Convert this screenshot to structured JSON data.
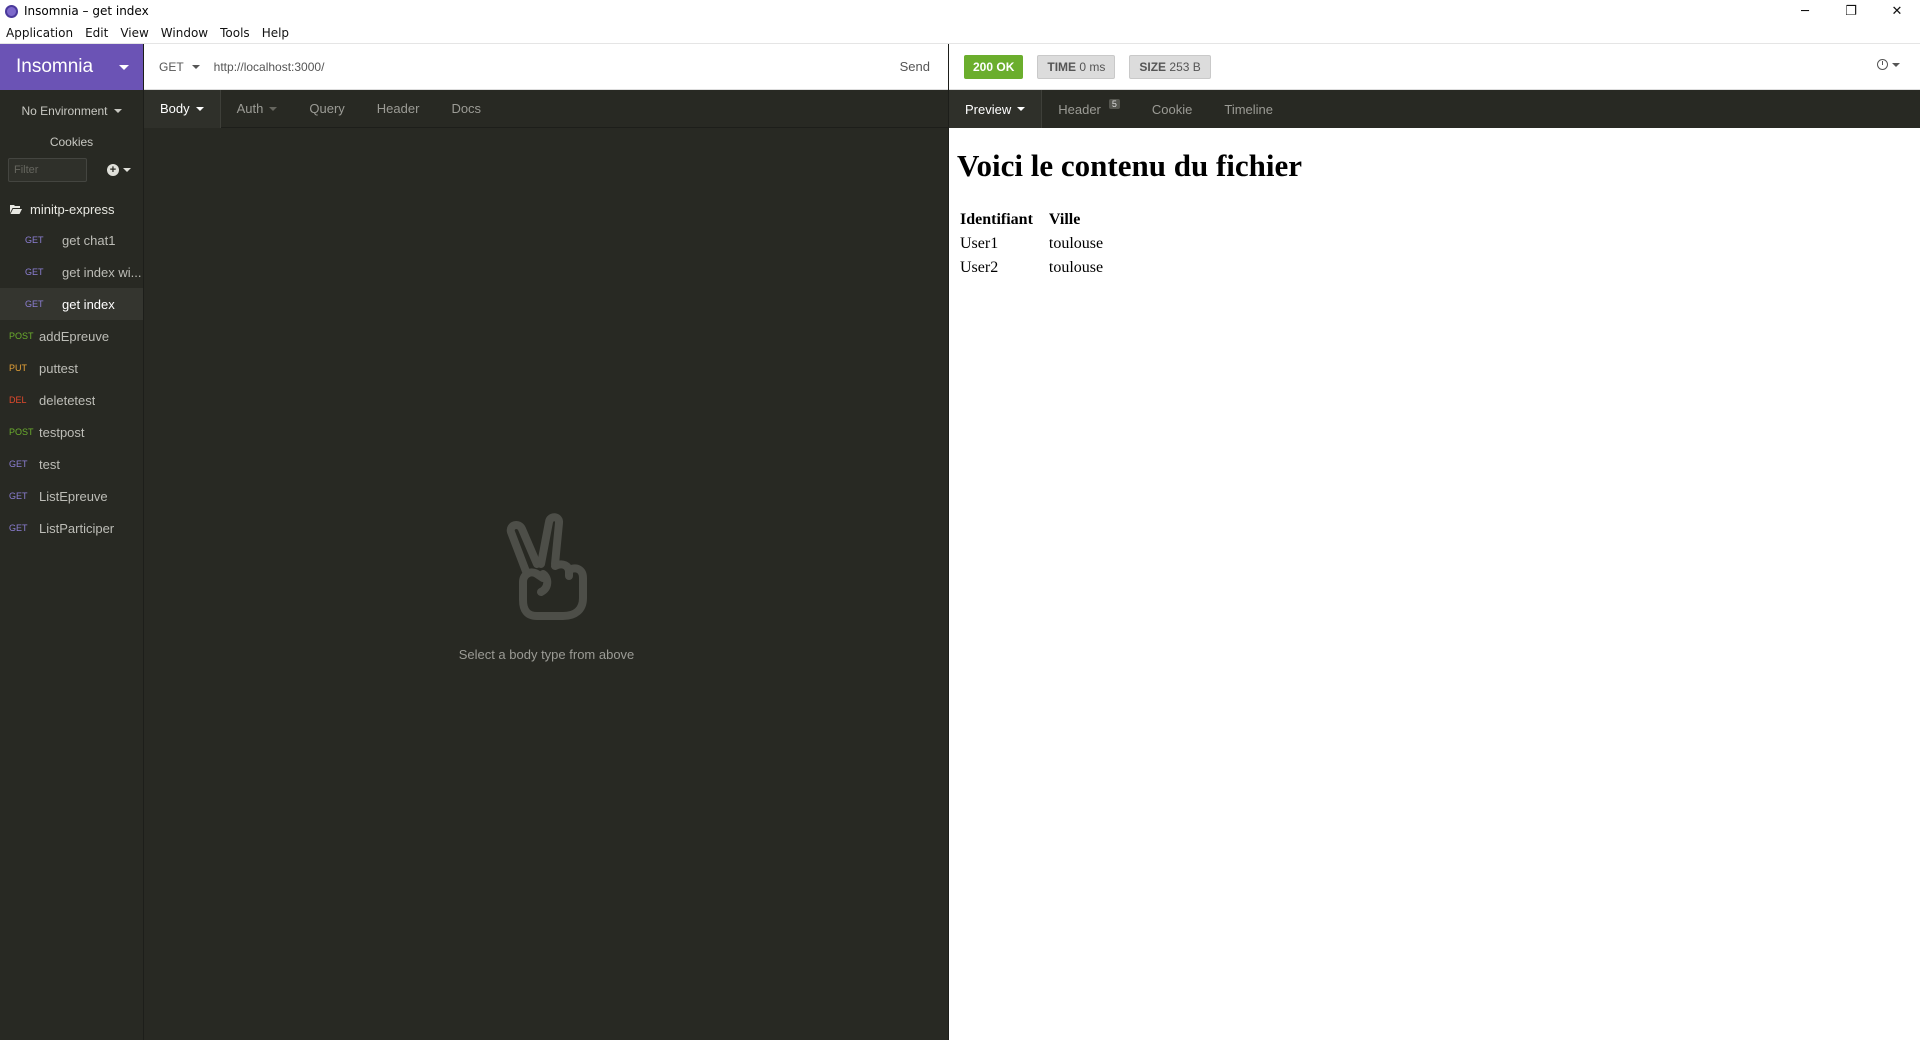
{
  "window": {
    "title": "Insomnia – get index",
    "controls": {
      "minimize": "─",
      "restore": "❐",
      "close": "✕"
    }
  },
  "menu": [
    "Application",
    "Edit",
    "View",
    "Window",
    "Tools",
    "Help"
  ],
  "sidebar": {
    "brand": "Insomnia",
    "environment": "No Environment",
    "cookies": "Cookies",
    "filter_placeholder": "Filter",
    "folder": "minitp-express",
    "folder_requests": [
      {
        "method": "GET",
        "label": "get chat1",
        "active": false
      },
      {
        "method": "GET",
        "label": "get index wi...",
        "active": false
      },
      {
        "method": "GET",
        "label": "get index",
        "active": true
      }
    ],
    "requests": [
      {
        "method": "POST",
        "label": "addEpreuve"
      },
      {
        "method": "PUT",
        "label": "puttest"
      },
      {
        "method": "DEL",
        "label": "deletetest"
      },
      {
        "method": "POST",
        "label": "testpost"
      },
      {
        "method": "GET",
        "label": "test"
      },
      {
        "method": "GET",
        "label": "ListEpreuve"
      },
      {
        "method": "GET",
        "label": "ListParticiper"
      }
    ],
    "method_colors": {
      "GET": "#8c7fd4",
      "POST": "#6bae2d",
      "PUT": "#e6a237",
      "DEL": "#e3492c"
    }
  },
  "request": {
    "method": "GET",
    "url": "http://localhost:3000/",
    "send": "Send",
    "tabs": {
      "body": "Body",
      "auth": "Auth",
      "query": "Query",
      "header": "Header",
      "docs": "Docs"
    },
    "empty_text": "Select a body type from above"
  },
  "response": {
    "status": "200 OK",
    "time_label": "TIME",
    "time_value": "0 ms",
    "size_label": "SIZE",
    "size_value": "253 B",
    "tabs": {
      "preview": "Preview",
      "header": "Header",
      "header_count": "5",
      "cookie": "Cookie",
      "timeline": "Timeline"
    },
    "preview": {
      "heading": "Voici le contenu du fichier",
      "columns": [
        "Identifiant",
        "Ville"
      ],
      "rows": [
        [
          "User1",
          "toulouse"
        ],
        [
          "User2",
          "toulouse"
        ]
      ]
    }
  }
}
